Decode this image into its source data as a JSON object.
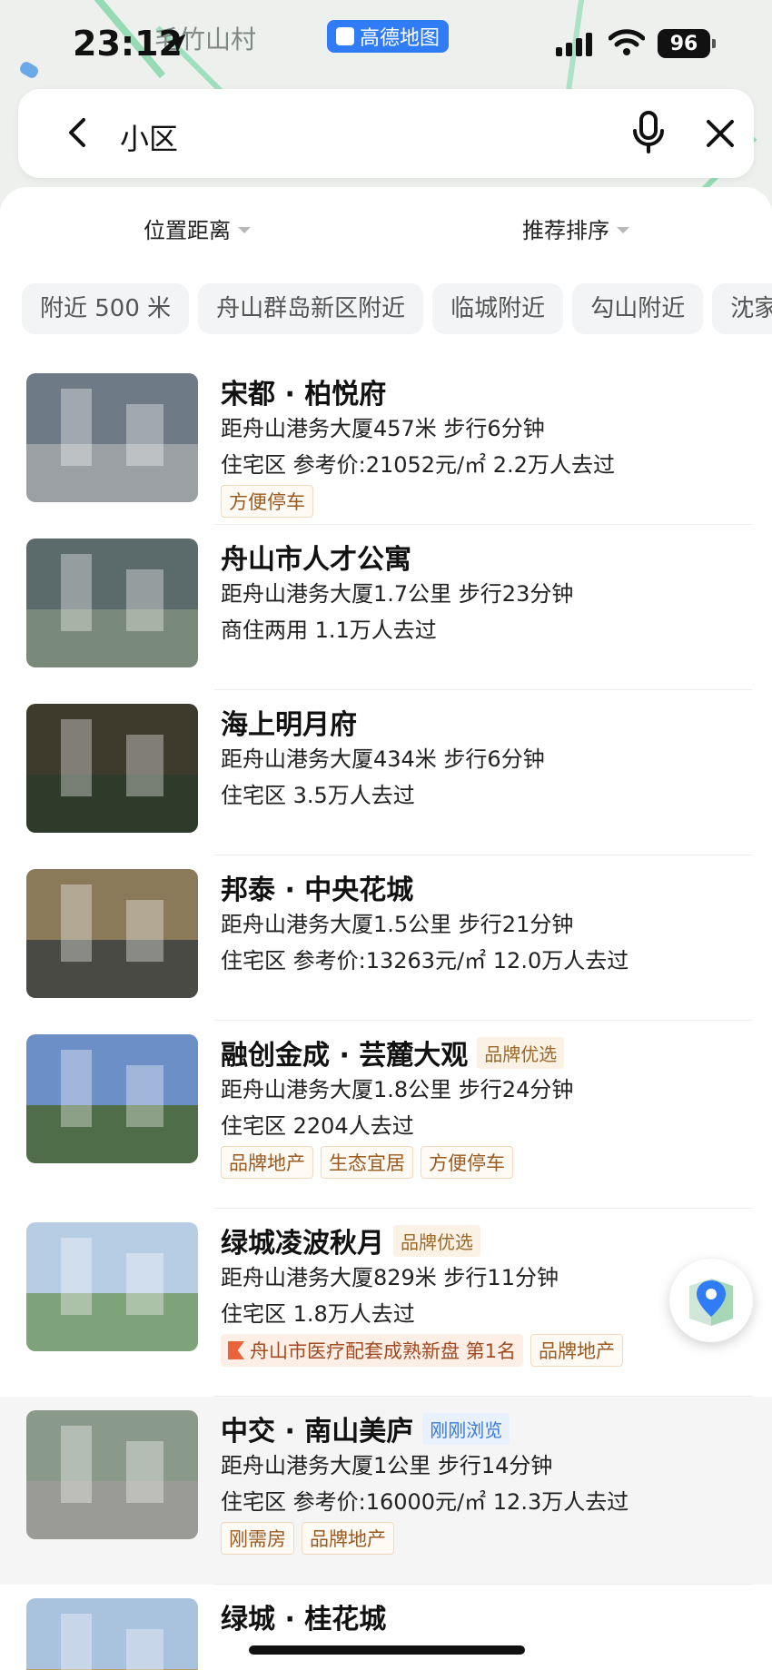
{
  "status_bar": {
    "time": "23:12",
    "map_place_label": "毛竹山村",
    "app_pill": "高德地图",
    "battery": "96"
  },
  "search": {
    "query": "小区"
  },
  "filters": {
    "distance": "位置距离",
    "sort": "推荐排序"
  },
  "chips": [
    "附近 500 米",
    "舟山群岛新区附近",
    "临城附近",
    "勾山附近",
    "沈家"
  ],
  "results": [
    {
      "name": "宋都 · 柏悦府",
      "badge": "",
      "distance_line": "距舟山港务大厦457米  步行6分钟",
      "detail_line": "住宅区  参考价:21052元/㎡  2.2万人去过",
      "tags": [
        "方便停车"
      ],
      "rank_tag": ""
    },
    {
      "name": "舟山市人才公寓",
      "badge": "",
      "distance_line": "距舟山港务大厦1.7公里  步行23分钟",
      "detail_line": "商住两用  1.1万人去过",
      "tags": [],
      "rank_tag": ""
    },
    {
      "name": "海上明月府",
      "badge": "",
      "distance_line": "距舟山港务大厦434米  步行6分钟",
      "detail_line": "住宅区  3.5万人去过",
      "tags": [],
      "rank_tag": ""
    },
    {
      "name": "邦泰 · 中央花城",
      "badge": "",
      "distance_line": "距舟山港务大厦1.5公里  步行21分钟",
      "detail_line": "住宅区  参考价:13263元/㎡  12.0万人去过",
      "tags": [],
      "rank_tag": ""
    },
    {
      "name": "融创金成 · 芸麓大观",
      "badge": "品牌优选",
      "badge_type": "brand",
      "distance_line": "距舟山港务大厦1.8公里  步行24分钟",
      "detail_line": "住宅区  2204人去过",
      "tags": [
        "品牌地产",
        "生态宜居",
        "方便停车"
      ],
      "rank_tag": ""
    },
    {
      "name": "绿城凌波秋月",
      "badge": "品牌优选",
      "badge_type": "brand",
      "distance_line": "距舟山港务大厦829米  步行11分钟",
      "detail_line": "住宅区  1.8万人去过",
      "tags": [
        "品牌地产"
      ],
      "rank_tag": "舟山市医疗配套成熟新盘 第1名"
    },
    {
      "name": "中交 · 南山美庐",
      "badge": "刚刚浏览",
      "badge_type": "viewed",
      "distance_line": "距舟山港务大厦1公里  步行14分钟",
      "detail_line": "住宅区  参考价:16000元/㎡  12.3万人去过",
      "tags": [
        "刚需房",
        "品牌地产"
      ],
      "rank_tag": ""
    },
    {
      "name": "绿城 · 桂花城",
      "badge": "",
      "distance_line": "",
      "detail_line": "",
      "tags": [],
      "rank_tag": ""
    }
  ],
  "colors": {
    "accent_blue": "#2f7cf6",
    "tag_text": "#9a5a20",
    "brand_badge_bg": "#fbf1e4",
    "viewed_badge_text": "#3a7ad9"
  },
  "icons": [
    "back-icon",
    "mic-icon",
    "close-icon",
    "location-arrow-icon",
    "signal-icon",
    "wifi-icon",
    "map-pin-icon"
  ]
}
